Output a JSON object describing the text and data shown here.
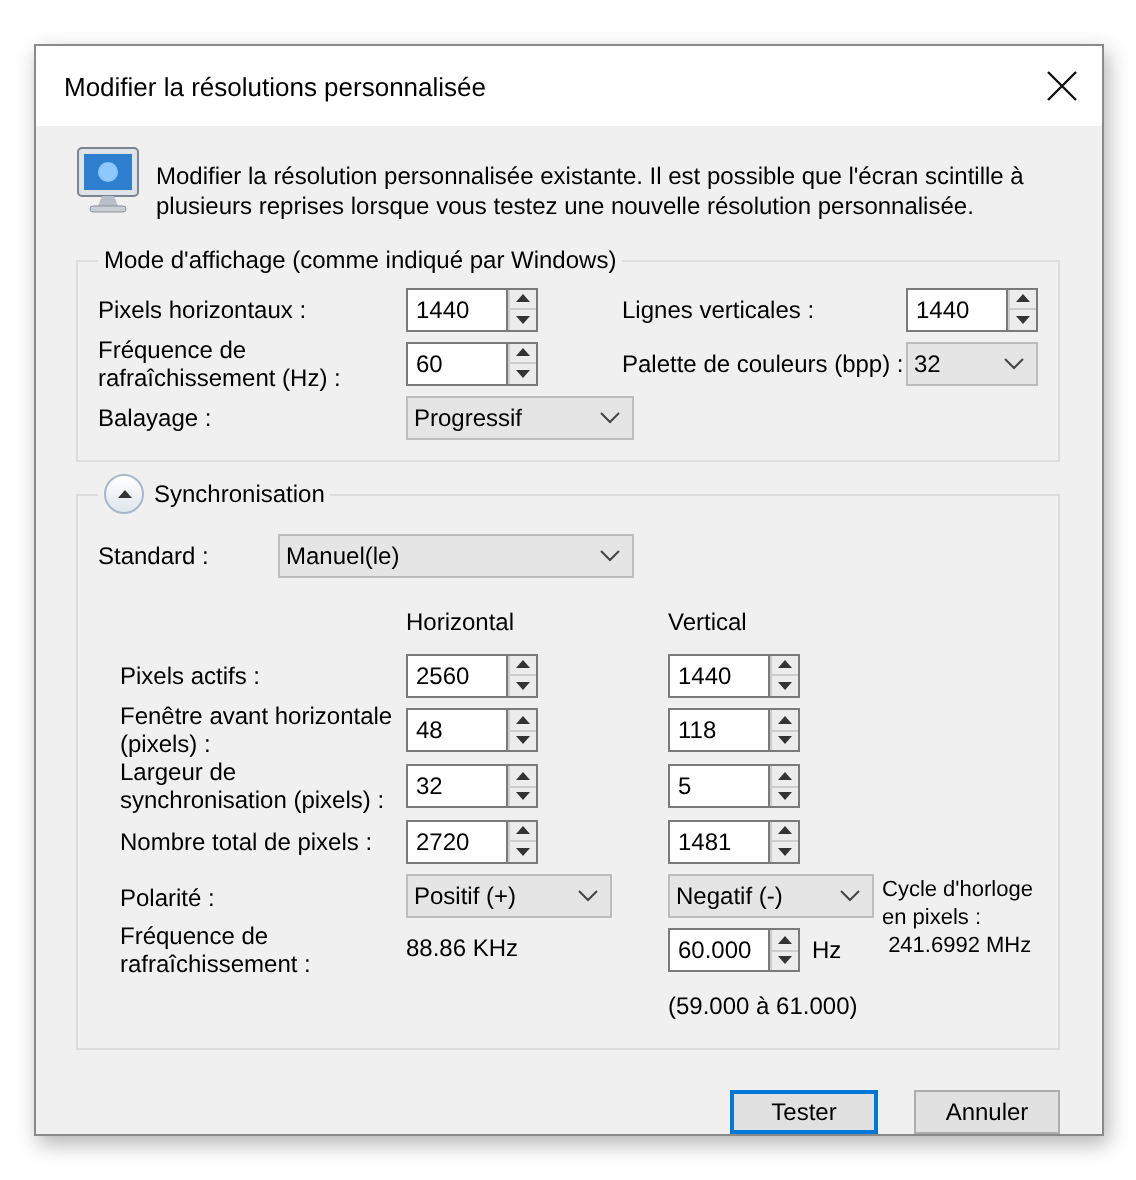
{
  "window": {
    "title": "Modifier la résolutions personnalisée"
  },
  "description": "Modifier la résolution personnalisée existante. Il est possible que l'écran scintille à plusieurs reprises lorsque vous testez une nouvelle résolution personnalisée.",
  "display_mode": {
    "title": "Mode d'affichage (comme indiqué par Windows)",
    "horizontal_pixels": {
      "label": "Pixels horizontaux :",
      "value": "1440"
    },
    "vertical_lines": {
      "label": "Lignes verticales :",
      "value": "1440"
    },
    "refresh_rate": {
      "label": "Fréquence de rafraîchissement (Hz) :",
      "value": "60"
    },
    "color_palette": {
      "label": "Palette de couleurs (bpp) :",
      "value": "32"
    },
    "scan": {
      "label": "Balayage :",
      "value": "Progressif"
    }
  },
  "sync": {
    "title": "Synchronisation",
    "expanded": true,
    "standard": {
      "label": "Standard :",
      "value": "Manuel(le)"
    },
    "column_headers": [
      "Horizontal",
      "Vertical"
    ],
    "rows": [
      {
        "label": "Pixels actifs :",
        "horizontal": "2560",
        "vertical": "1440"
      },
      {
        "label": "Fenêtre avant horizontale (pixels) :",
        "horizontal": "48",
        "vertical": "118"
      },
      {
        "label": "Largeur de synchronisation (pixels) :",
        "horizontal": "32",
        "vertical": "5"
      },
      {
        "label": "Nombre total de pixels :",
        "horizontal": "2720",
        "vertical": "1481"
      }
    ],
    "polarity": {
      "label": "Polarité :",
      "horizontal": "Positif (+)",
      "vertical": "Negatif (-)"
    },
    "refresh": {
      "label": "Fréquence de rafraîchissement :",
      "horizontal": "88.86 KHz",
      "vertical": "60.000",
      "unit": "Hz",
      "range": "(59.000 à 61.000)"
    },
    "pixel_clock": {
      "label": "Cycle d'horloge en pixels :",
      "value": "241.6992 MHz"
    }
  },
  "buttons": [
    {
      "label": "Tester",
      "default": true
    },
    {
      "label": "Annuler",
      "default": false
    }
  ]
}
